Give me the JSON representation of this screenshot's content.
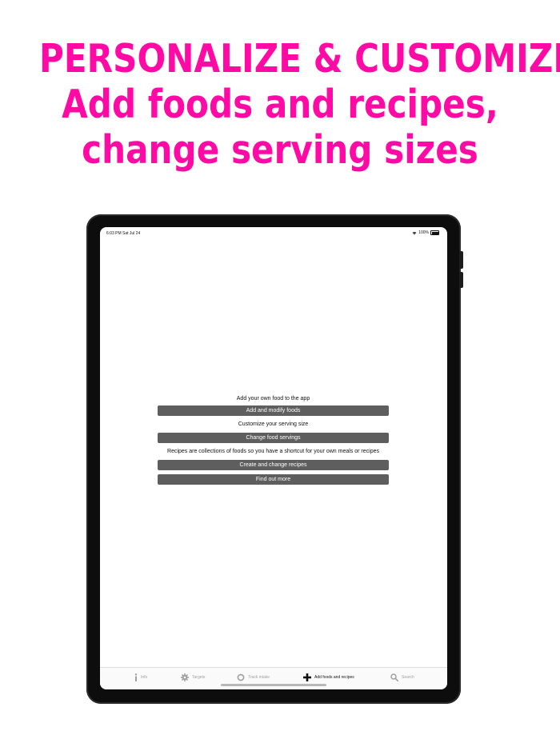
{
  "headline": {
    "line1": "PERSONALIZE & CUSTOMIZE",
    "line2": "Add foods and recipes,",
    "line3": "change serving sizes"
  },
  "status_bar": {
    "time": "6:03 PM  Sat Jul 24",
    "battery": "100%"
  },
  "main": {
    "add_food_caption": "Add your own food to the app",
    "add_food_button": "Add and modify foods",
    "serving_caption": "Customize your serving size",
    "serving_button": "Change food servings",
    "recipes_caption": "Recipes are collections of foods so you have a shortcut for your own meals or recipes",
    "recipes_button": "Create and change recipes",
    "find_out_button": "Find out more"
  },
  "tab_bar": {
    "items": [
      {
        "label": "Info",
        "icon": "info-icon",
        "active": false
      },
      {
        "label": "Targets",
        "icon": "gear-icon",
        "active": false
      },
      {
        "label": "Track intake",
        "icon": "circle-icon",
        "active": false
      },
      {
        "label": "Add foods and recipes",
        "icon": "plus-icon",
        "active": true
      },
      {
        "label": "Search",
        "icon": "search-icon",
        "active": false
      }
    ]
  },
  "colors": {
    "headline": "#ff0aa5",
    "button": "#5e5e5e",
    "tab_inactive": "#a0a0a0",
    "tab_active": "#111111"
  }
}
